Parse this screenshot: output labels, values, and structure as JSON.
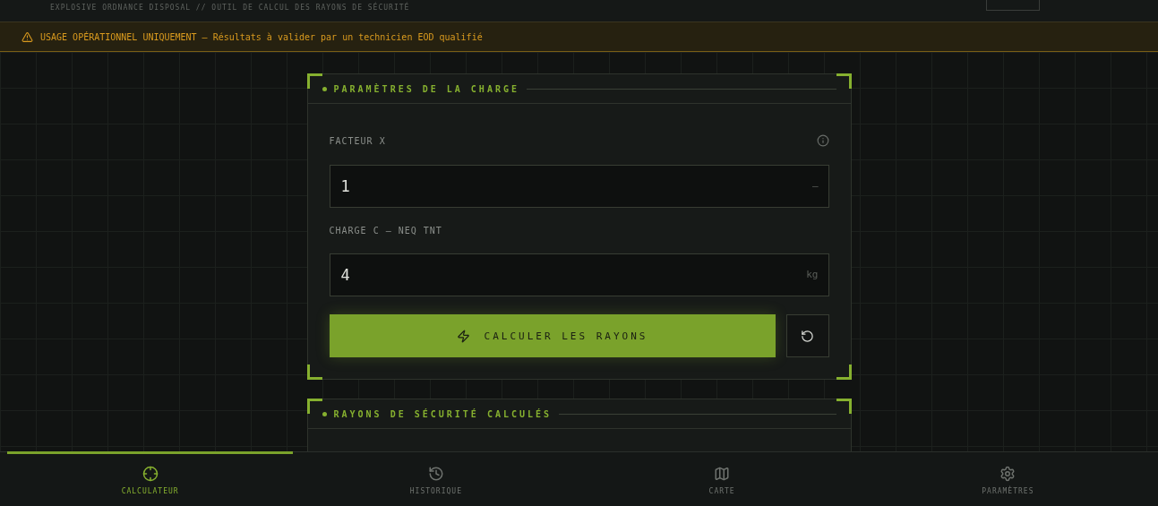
{
  "header": {
    "subtitle": "EXPLOSIVE ORDNANCE DISPOSAL // OUTIL DE CALCUL DES RAYONS DE SÉCURITÉ"
  },
  "warning": {
    "text": "USAGE OPÉRATIONNEL UNIQUEMENT — Résultats à valider par un technicien EOD qualifié"
  },
  "charge_panel": {
    "title": "PARAMÈTRES DE LA CHARGE",
    "fields": [
      {
        "label": "FACTEUR X",
        "value": "1",
        "unit": "—",
        "info": true
      },
      {
        "label": "CHARGE C — NEQ TNT",
        "value": "4",
        "unit": "kg",
        "info": false
      }
    ],
    "calculate_button": "CALCULER LES RAYONS"
  },
  "results_panel": {
    "title": "RAYONS DE SÉCURITÉ CALCULÉS"
  },
  "nav": [
    {
      "label": "CALCULATEUR",
      "selected": true
    },
    {
      "label": "HISTORIQUE",
      "selected": false
    },
    {
      "label": "CARTE",
      "selected": false
    },
    {
      "label": "PARAMÈTRES",
      "selected": false
    }
  ]
}
